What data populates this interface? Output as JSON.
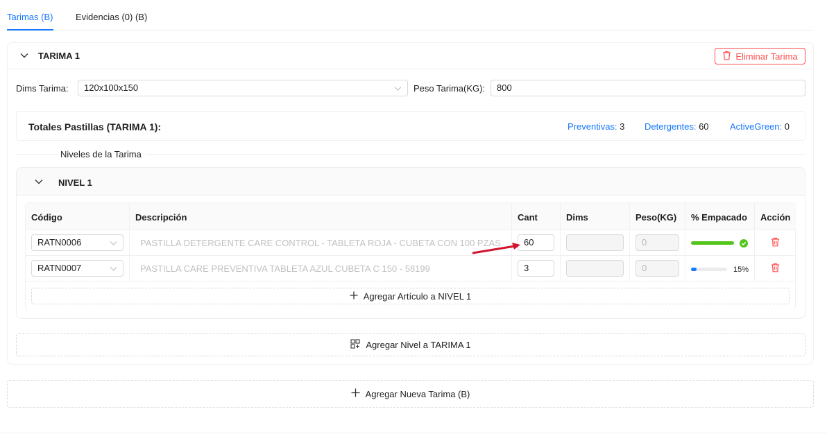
{
  "tabs": [
    {
      "label": "Tarimas (B)",
      "active": true
    },
    {
      "label": "Evidencias (0) (B)",
      "active": false
    }
  ],
  "tarima": {
    "title": "TARIMA 1",
    "delete_label": "Eliminar Tarima",
    "dims_label": "Dims Tarima",
    "dims_value": "120x100x150",
    "peso_label": "Peso Tarima(KG):",
    "peso_value": "800",
    "totals": {
      "title": "Totales Pastillas (TARIMA 1):",
      "items": [
        {
          "label": "Preventivas:",
          "value": "3"
        },
        {
          "label": "Detergentes:",
          "value": "60"
        },
        {
          "label": "ActiveGreen:",
          "value": "0"
        }
      ]
    },
    "niveles_label": "Niveles de la Tarima",
    "nivel": {
      "title": "NIVEL 1",
      "columns": [
        "Código",
        "Descripción",
        "Cant",
        "Dims",
        "Peso(KG)",
        "% Empacado",
        "Acción"
      ],
      "rows": [
        {
          "codigo": "RATN0006",
          "descripcion": "PASTILLA DETERGENTE CARE CONTROL - TABLETA ROJA - CUBETA CON 100 PZAS -",
          "cant": "60",
          "dims": "",
          "peso": "0",
          "empacado_pct": 100,
          "empacado_label": "",
          "bar_color": "#52c41a"
        },
        {
          "codigo": "RATN0007",
          "descripcion": "PASTILLA CARE PREVENTIVA TABLETA AZUL CUBETA C 150 - 58199",
          "cant": "3",
          "dims": "",
          "peso": "0",
          "empacado_pct": 15,
          "empacado_label": "15%",
          "bar_color": "#1677ff"
        }
      ],
      "add_article_label": "Agregar Artículo a NIVEL 1"
    },
    "add_nivel_label": "Agregar Nivel a TARIMA 1"
  },
  "add_tarima_label": "Agregar Nueva Tarima (B)",
  "colors": {
    "accent": "#1677ff",
    "danger": "#ff4d4f",
    "success": "#52c41a",
    "annotation_arrow": "#d0142c"
  }
}
